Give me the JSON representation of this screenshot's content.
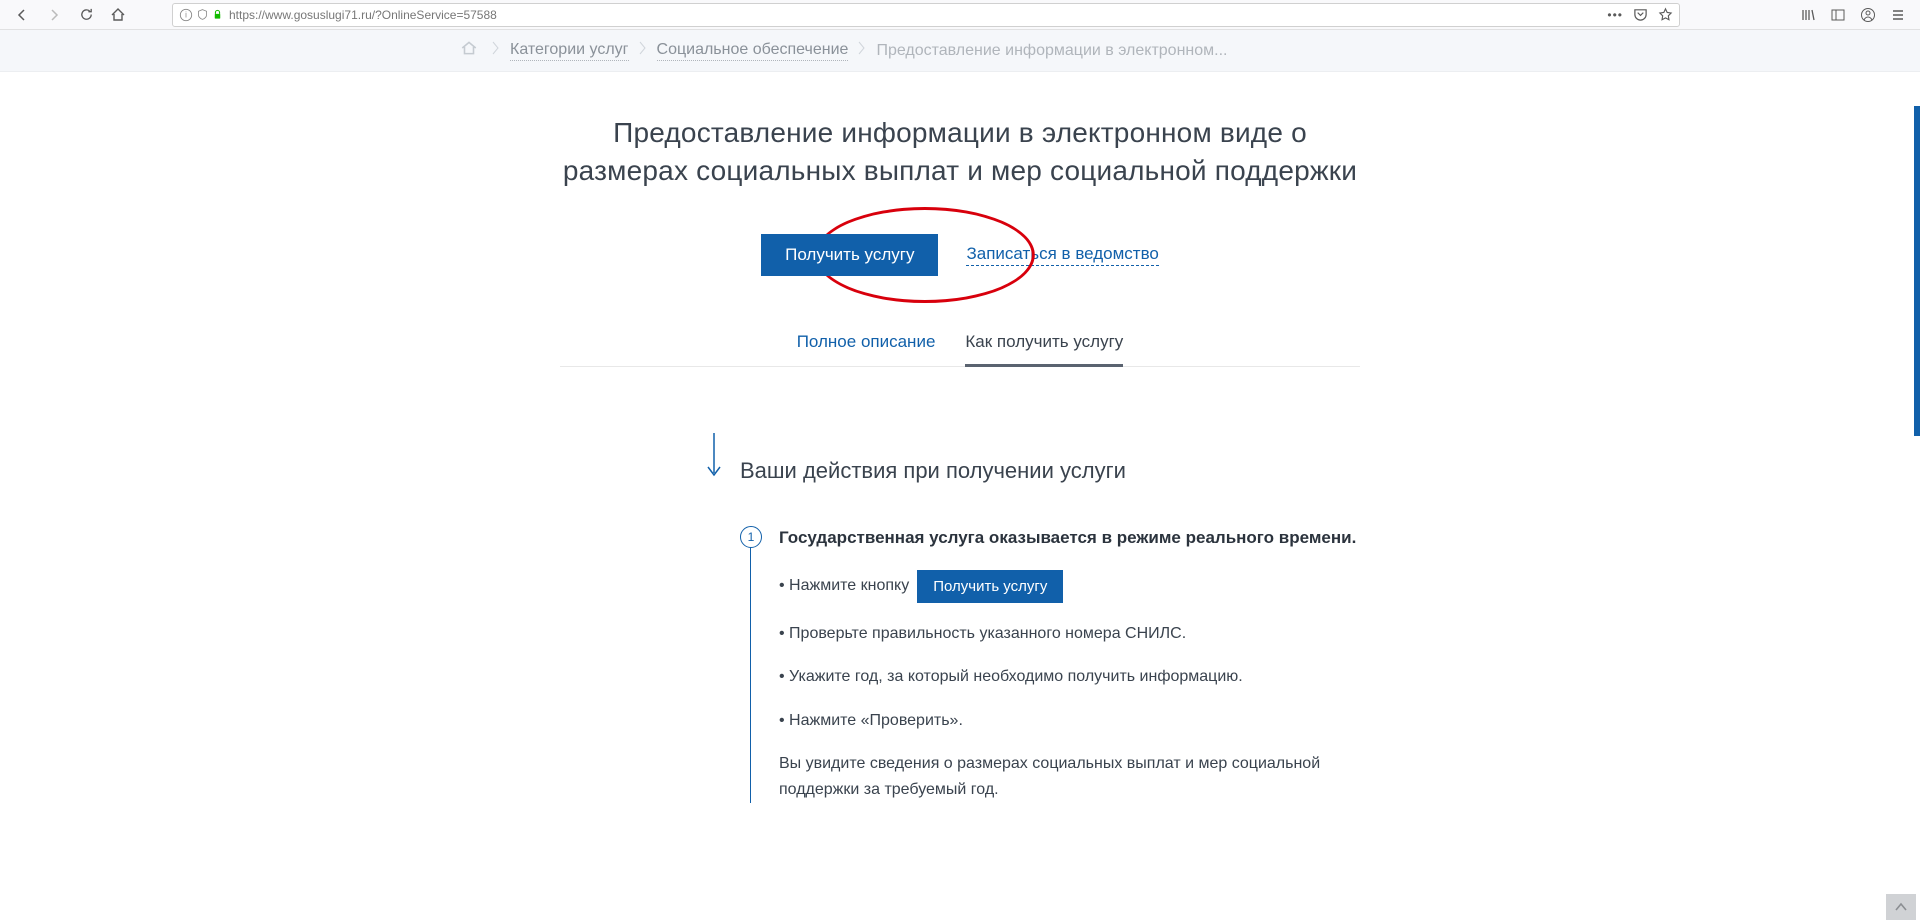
{
  "browser": {
    "url": "https://www.gosuslugi71.ru/?OnlineService=57588"
  },
  "breadcrumb": {
    "items": [
      {
        "label": "Категории услуг"
      },
      {
        "label": "Социальное обеспечение"
      },
      {
        "label": "Предоставление информации в электронном..."
      }
    ]
  },
  "page_title": "Предоставление информации в электронном виде о размерах социальных выплат и мер социальной поддержки",
  "cta": {
    "primary": "Получить услугу",
    "secondary": "Записаться в ведомство"
  },
  "tabs": {
    "full_desc": "Полное описание",
    "how_to": "Как получить услугу"
  },
  "steps": {
    "heading": "Ваши действия при получении услуги",
    "step1": {
      "num": "1",
      "title": "Государственная услуга оказывается в режиме реального времени.",
      "line1_prefix": "• Нажмите кнопку",
      "line1_button": "Получить услугу",
      "line2": "• Проверьте правильность указанного номера СНИЛС.",
      "line3": "• Укажите год, за который необходимо получить информацию.",
      "line4": "• Нажмите «Проверить».",
      "line5": "Вы увидите сведения о размерах социальных выплат и мер социальной поддержки за требуемый год."
    }
  }
}
